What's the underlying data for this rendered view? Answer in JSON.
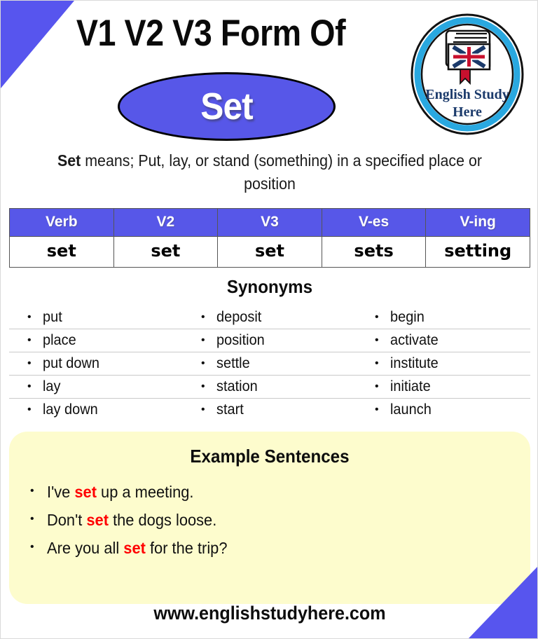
{
  "header": {
    "title": "V1 V2 V3 Form Of",
    "word": "Set"
  },
  "logo": {
    "line1": "English Study",
    "line2": "Here"
  },
  "definition": {
    "term": "Set",
    "rest": " means; Put, lay, or stand (something) in a specified place or position"
  },
  "verb_table": {
    "headers": [
      "Verb",
      "V2",
      "V3",
      "V-es",
      "V-ing"
    ],
    "row": [
      "set",
      "set",
      "set",
      "sets",
      "setting"
    ]
  },
  "synonyms": {
    "title": "Synonyms",
    "rows": [
      [
        "put",
        "deposit",
        "begin"
      ],
      [
        "place",
        "position",
        "activate"
      ],
      [
        "put down",
        "settle",
        "institute"
      ],
      [
        "lay",
        "station",
        "initiate"
      ],
      [
        "lay down",
        "start",
        "launch"
      ]
    ],
    "bullet": "•"
  },
  "examples": {
    "title": "Example Sentences",
    "bullet": "•",
    "items": [
      {
        "before": "I've ",
        "highlight": "set",
        "after": " up a meeting."
      },
      {
        "before": "Don't ",
        "highlight": "set",
        "after": " the dogs loose."
      },
      {
        "before": "Are you all ",
        "highlight": "set",
        "after": " for the trip?"
      }
    ]
  },
  "footer": {
    "url": "www.englishstudyhere.com"
  },
  "colors": {
    "accent_blue": "#5757e8",
    "corner_blue": "#5755ee",
    "example_bg": "#fdfccd",
    "highlight_red": "#ff0000",
    "logo_ring": "#29a8e0",
    "logo_text": "#1b3a6b"
  }
}
